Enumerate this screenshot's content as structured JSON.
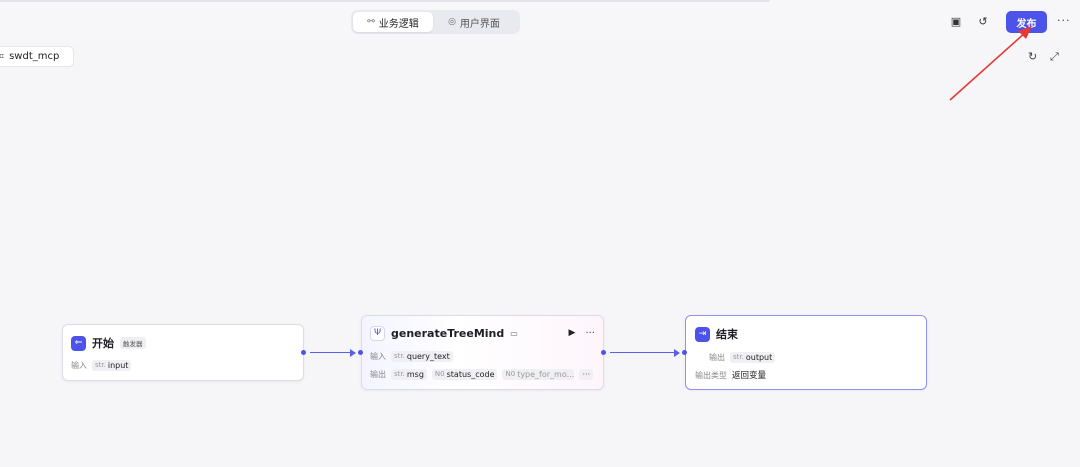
{
  "header": {
    "tabs": [
      {
        "label": "业务逻辑",
        "icon": "flow-icon",
        "active": true
      },
      {
        "label": "用户界面",
        "icon": "palette-icon",
        "active": false
      }
    ],
    "publish_label": "发布",
    "more_label": "···"
  },
  "canvas": {
    "project_name": "swdt_mcp"
  },
  "nodes": {
    "start": {
      "title": "开始",
      "badge": "触发器",
      "input_label": "输入",
      "input_type": "str.",
      "input_name": "input"
    },
    "process": {
      "title": "generateTreeMind",
      "input_label": "输入",
      "input_type": "str.",
      "input_name": "query_text",
      "output_label": "输出",
      "outputs": [
        {
          "type": "str.",
          "name": "msg"
        },
        {
          "type": "N0",
          "name": "status_code"
        },
        {
          "type": "N0",
          "name": "type_for_mo..."
        }
      ],
      "more_outputs": "···"
    },
    "end": {
      "title": "结束",
      "output_label": "输出",
      "output_type": "str.",
      "output_name": "output",
      "output_kind_label": "输出类型",
      "output_kind_value": "返回变量"
    }
  },
  "colors": {
    "accent": "#4d53e8",
    "annotation": "#e53935"
  }
}
